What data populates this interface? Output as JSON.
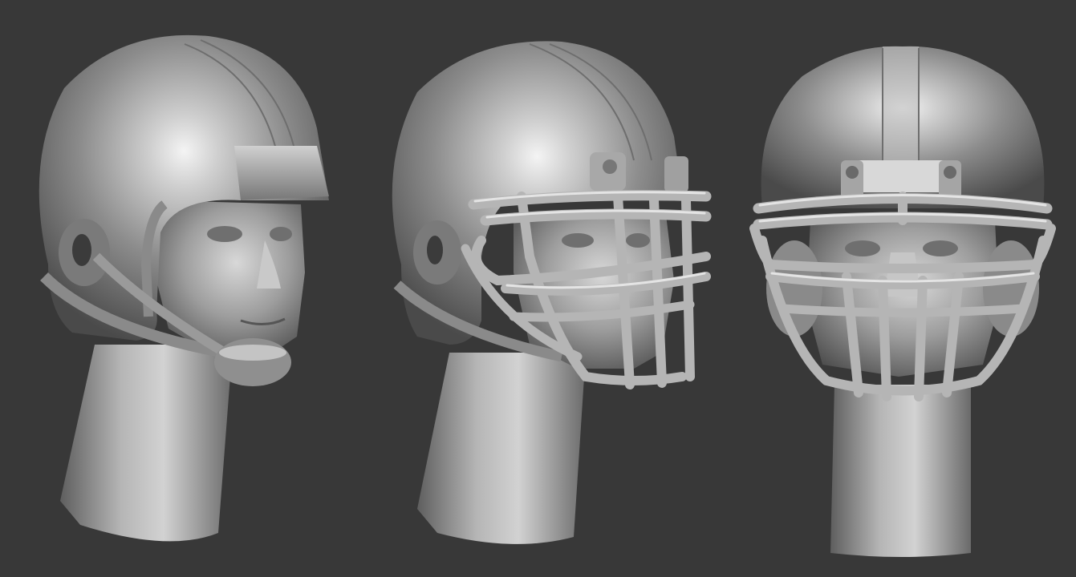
{
  "scene": {
    "background_color": "#383838",
    "material_color": "#9a9a9a",
    "highlight_color": "#f2f2f2",
    "shadow_color": "#3e3e3e",
    "models": [
      {
        "name": "helmet-side-view-no-facemask",
        "facemask": false
      },
      {
        "name": "helmet-three-quarter-view-with-facemask",
        "facemask": true
      },
      {
        "name": "helmet-front-view-with-facemask",
        "facemask": true
      }
    ]
  }
}
